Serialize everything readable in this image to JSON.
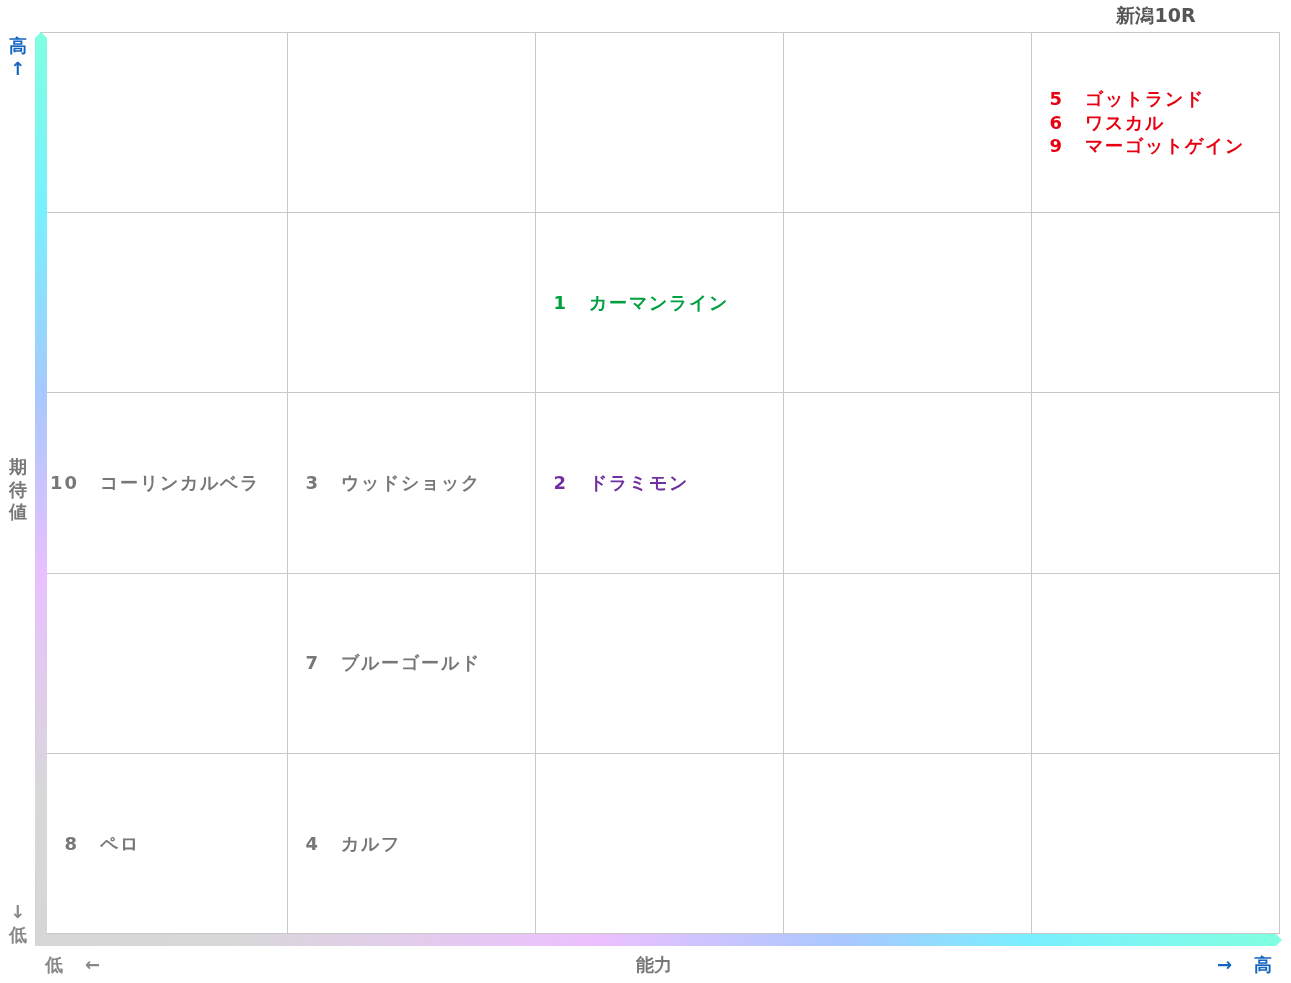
{
  "title": "新潟10R",
  "y_axis": {
    "high": "高",
    "high_arrow": "↑",
    "label": "期待値",
    "low_arrow": "↓",
    "low": "低"
  },
  "x_axis": {
    "low": "低",
    "low_arrow": "←",
    "label": "能力",
    "high_arrow": "→",
    "high": "高"
  },
  "rows": [
    {
      "cells": [
        {},
        {},
        {},
        {},
        {
          "horses": [
            {
              "number": "5",
              "name": "ゴットランド",
              "color": "#e60012"
            },
            {
              "number": "6",
              "name": "ワスカル",
              "color": "#e60012"
            },
            {
              "number": "9",
              "name": "マーゴットゲイン",
              "color": "#e60012"
            }
          ]
        }
      ]
    },
    {
      "cells": [
        {},
        {},
        {
          "horses": [
            {
              "number": "1",
              "name": "カーマンライン",
              "color": "#00a040"
            }
          ]
        },
        {},
        {}
      ]
    },
    {
      "cells": [
        {
          "horses": [
            {
              "number": "10",
              "name": "コーリンカルベラ",
              "color": "#777777"
            }
          ]
        },
        {
          "horses": [
            {
              "number": "3",
              "name": "ウッドショック",
              "color": "#777777"
            }
          ]
        },
        {
          "horses": [
            {
              "number": "2",
              "name": "ドラミモン",
              "color": "#7030a0"
            }
          ]
        },
        {},
        {}
      ]
    },
    {
      "cells": [
        {},
        {
          "horses": [
            {
              "number": "7",
              "name": "ブルーゴールド",
              "color": "#777777"
            }
          ]
        },
        {},
        {},
        {}
      ]
    },
    {
      "cells": [
        {
          "horses": [
            {
              "number": "8",
              "name": "ペロ",
              "color": "#777777"
            }
          ]
        },
        {
          "horses": [
            {
              "number": "4",
              "name": "カルフ",
              "color": "#777777"
            }
          ]
        },
        {},
        {},
        {}
      ]
    }
  ]
}
